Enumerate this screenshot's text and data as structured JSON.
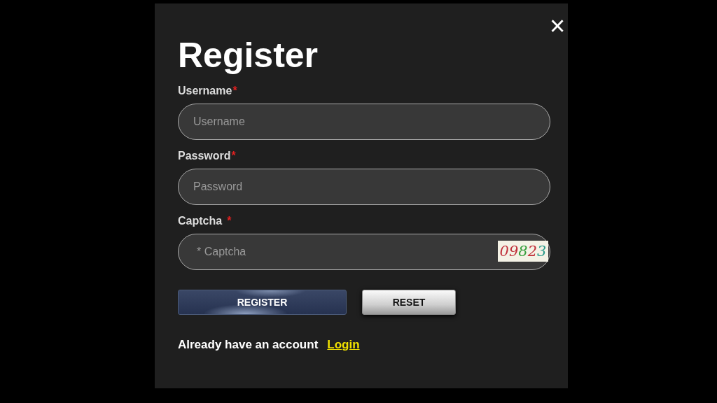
{
  "dialog": {
    "title": "Register",
    "close": "×"
  },
  "fields": [
    {
      "label": "Username",
      "required": "*",
      "placeholder": "Username",
      "kind": "text"
    },
    {
      "label": "Password",
      "required": "*",
      "placeholder": "Password",
      "kind": "password"
    },
    {
      "label": "Captcha",
      "required": "*",
      "placeholder": "* Captcha",
      "kind": "captcha",
      "captcha_digits": [
        {
          "text": "0",
          "color": "#c0303a"
        },
        {
          "text": "9",
          "color": "#c0303a"
        },
        {
          "text": "8",
          "color": "#3aa040"
        },
        {
          "text": "2",
          "color": "#c0303a"
        },
        {
          "text": "3",
          "color": "#2a9a8a"
        }
      ]
    }
  ],
  "buttons": [
    {
      "label": "REGISTER",
      "kind": "primary"
    },
    {
      "label": "RESET",
      "kind": "secondary"
    }
  ],
  "footer": {
    "text": "Already have an account",
    "link": "Login"
  }
}
